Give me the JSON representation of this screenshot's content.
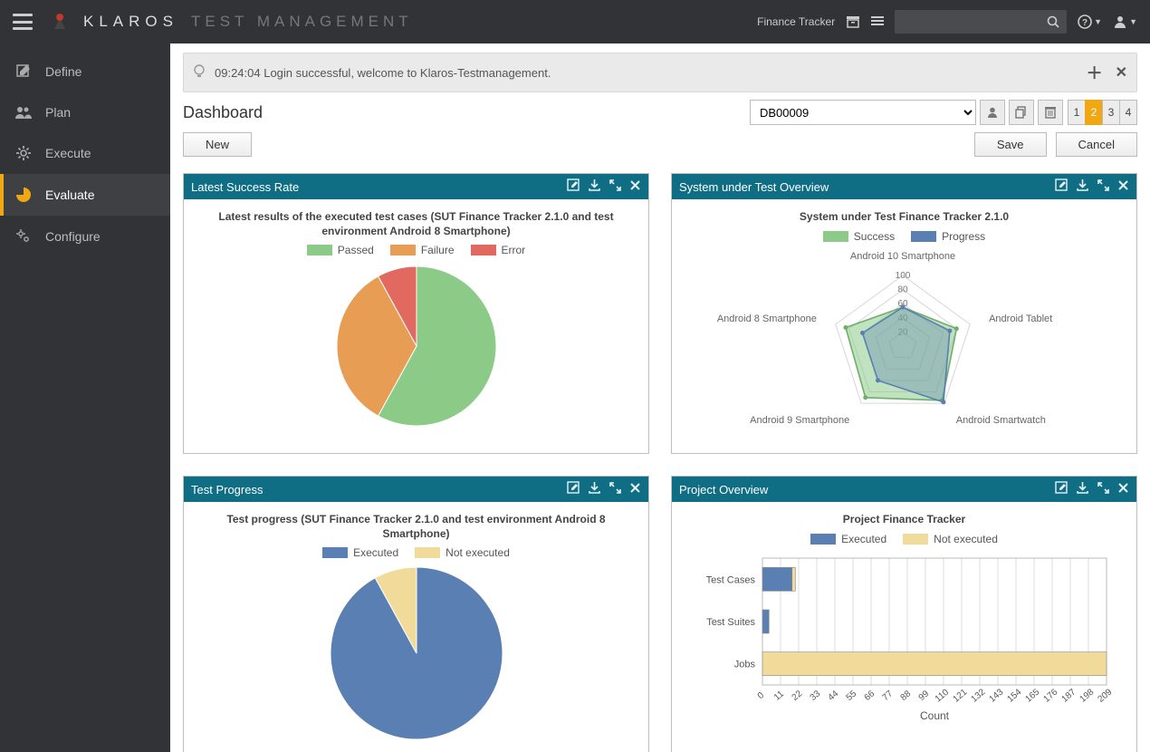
{
  "header": {
    "brand": "KLAROS",
    "brand_sub": "TEST MANAGEMENT",
    "project": "Finance Tracker",
    "search_placeholder": ""
  },
  "sidebar": {
    "items": [
      {
        "label": "Define"
      },
      {
        "label": "Plan"
      },
      {
        "label": "Execute"
      },
      {
        "label": "Evaluate"
      },
      {
        "label": "Configure"
      }
    ]
  },
  "notice": "09:24:04 Login successful, welcome to Klaros-Testmanagement.",
  "page": {
    "title": "Dashboard",
    "selected_dashboard": "DB00009",
    "layout_options": [
      "1",
      "2",
      "3",
      "4"
    ],
    "active_layout": "2",
    "actions": {
      "new": "New",
      "save": "Save",
      "cancel": "Cancel"
    }
  },
  "panels": {
    "success_rate": {
      "title": "Latest Success Rate",
      "chart_title": "Latest results of the executed test cases (SUT Finance Tracker 2.1.0 and test environment Android 8 Smartphone)",
      "legend": [
        "Passed",
        "Failure",
        "Error"
      ]
    },
    "sut_overview": {
      "title": "System under Test Overview",
      "chart_title": "System under Test Finance Tracker 2.1.0",
      "legend": [
        "Success",
        "Progress"
      ]
    },
    "test_progress": {
      "title": "Test Progress",
      "chart_title": "Test progress (SUT Finance Tracker 2.1.0 and test environment Android 8 Smartphone)",
      "legend": [
        "Executed",
        "Not executed"
      ]
    },
    "project_overview": {
      "title": "Project Overview",
      "chart_title": "Project Finance Tracker",
      "legend": [
        "Executed",
        "Not executed"
      ],
      "xlabel": "Count"
    }
  },
  "chart_data": [
    {
      "id": "success_rate",
      "type": "pie",
      "title": "Latest results of the executed test cases (SUT Finance Tracker 2.1.0 and test environment Android 8 Smartphone)",
      "series": [
        {
          "name": "Passed",
          "value": 58
        },
        {
          "name": "Failure",
          "value": 34
        },
        {
          "name": "Error",
          "value": 8
        }
      ]
    },
    {
      "id": "sut_overview",
      "type": "radar",
      "title": "System under Test Finance Tracker 2.1.0",
      "axes": [
        "Android 10 Smartphone",
        "Android Tablet",
        "Android Smartwatch",
        "Android 9 Smartphone",
        "Android 8 Smartphone"
      ],
      "ticks": [
        20,
        40,
        60,
        80,
        100
      ],
      "series": [
        {
          "name": "Success",
          "values": [
            55,
            80,
            95,
            90,
            85
          ]
        },
        {
          "name": "Progress",
          "values": [
            55,
            70,
            98,
            60,
            60
          ]
        }
      ]
    },
    {
      "id": "test_progress",
      "type": "pie",
      "title": "Test progress (SUT Finance Tracker 2.1.0 and test environment Android 8 Smartphone)",
      "series": [
        {
          "name": "Executed",
          "value": 92
        },
        {
          "name": "Not executed",
          "value": 8
        }
      ]
    },
    {
      "id": "project_overview",
      "type": "bar",
      "orientation": "horizontal",
      "title": "Project Finance Tracker",
      "xlabel": "Count",
      "xlim": [
        0,
        209
      ],
      "x_ticks": [
        0,
        11,
        22,
        33,
        44,
        55,
        66,
        77,
        88,
        99,
        110,
        121,
        132,
        143,
        154,
        165,
        176,
        187,
        198,
        209
      ],
      "categories": [
        "Test Cases",
        "Test Suites",
        "Jobs"
      ],
      "series": [
        {
          "name": "Executed",
          "values": [
            18,
            4,
            0
          ]
        },
        {
          "name": "Not executed",
          "values": [
            2,
            0,
            209
          ]
        }
      ]
    }
  ]
}
